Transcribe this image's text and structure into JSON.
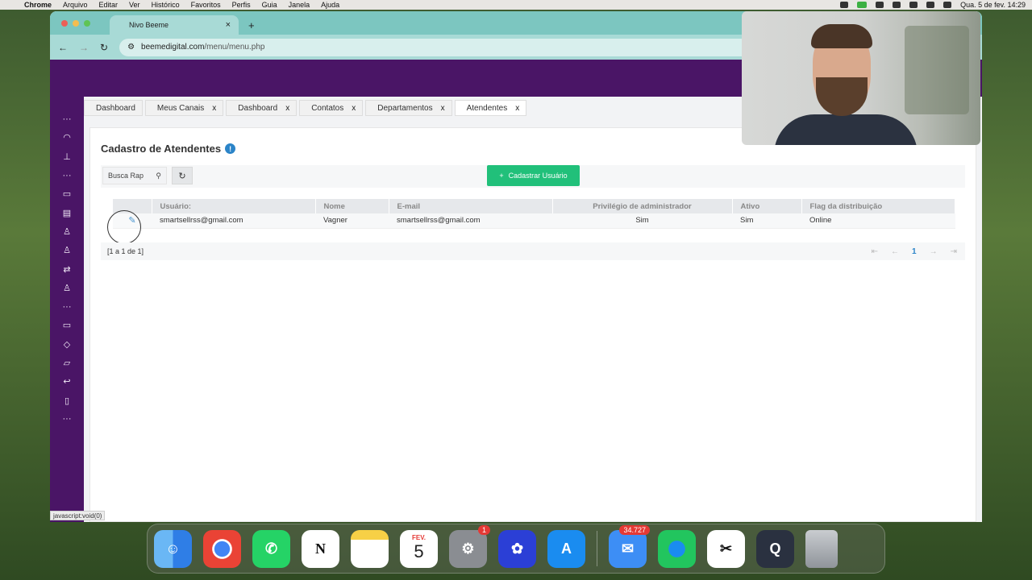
{
  "menubar": {
    "app": "Chrome",
    "items": [
      "Arquivo",
      "Editar",
      "Ver",
      "Histórico",
      "Favoritos",
      "Perfis",
      "Guia",
      "Janela",
      "Ajuda"
    ],
    "clock": "Qua. 5 de fev.  14:29"
  },
  "browser": {
    "tab_title": "Nivo Beeme",
    "url_host": "beemedigital.com",
    "url_path": "/menu/menu.php"
  },
  "app_tabs": [
    {
      "label": "Dashboard",
      "closable": false
    },
    {
      "label": "Meus Canais",
      "closable": true
    },
    {
      "label": "Dashboard",
      "closable": true
    },
    {
      "label": "Contatos",
      "closable": true
    },
    {
      "label": "Departamentos",
      "closable": true
    },
    {
      "label": "Atendentes",
      "closable": true,
      "active": true
    }
  ],
  "tab_close": "x",
  "page": {
    "title": "Cadastro de Atendentes",
    "info_icon": "!",
    "search_placeholder": "Busca Rap",
    "add_button": "Cadastrar Usuário"
  },
  "table": {
    "headers": [
      "Usuário:",
      "Nome",
      "E-mail",
      "Privilégio de administrador",
      "Ativo",
      "Flag da distribuição"
    ],
    "rows": [
      [
        "smartsellrss@gmail.com",
        "Vagner",
        "smartsellrss@gmail.com",
        "Sim",
        "Sim",
        "Online"
      ]
    ]
  },
  "footer": {
    "record_count": "[1 a 1 de 1]",
    "current_page": "1"
  },
  "status_url": "javascript:void(0)",
  "dock": {
    "calendar_month": "FEV.",
    "calendar_day": "5",
    "settings_badge": "1",
    "mail_badge": "34.727"
  },
  "colors": {
    "sidebar": "#4a1566",
    "accent_green": "#21c07a",
    "link_blue": "#2b84c8"
  }
}
